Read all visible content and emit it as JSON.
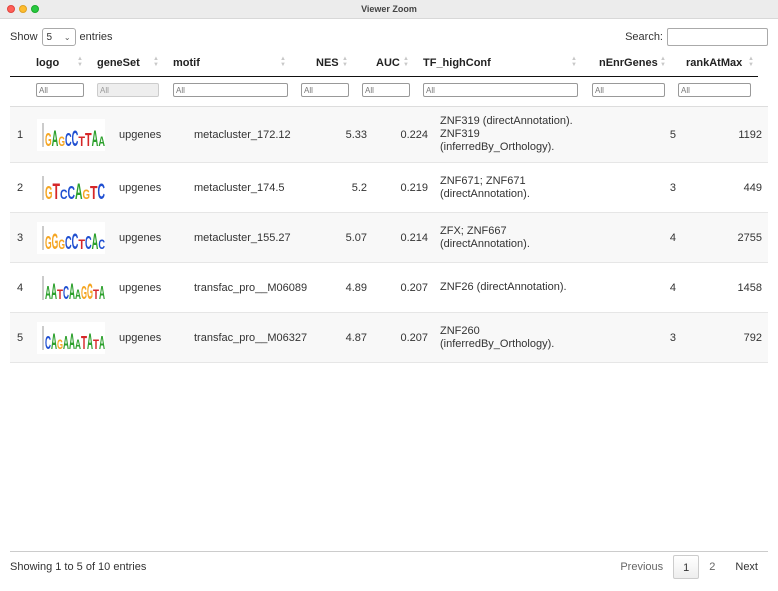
{
  "window": {
    "title": "Viewer Zoom"
  },
  "length_menu": {
    "show_label": "Show",
    "selected": "5",
    "entries_label": "entries"
  },
  "search": {
    "label": "Search:",
    "value": ""
  },
  "columns": [
    "logo",
    "geneSet",
    "motif",
    "NES",
    "AUC",
    "TF_highConf",
    "nEnrGenes",
    "rankAtMax"
  ],
  "filters": [
    "All",
    "All",
    "All",
    "All",
    "All",
    "All",
    "All",
    "All"
  ],
  "rows": [
    {
      "index": "1",
      "geneSet": "upgenes",
      "motif": "metacluster_172.12",
      "NES": "5.33",
      "AUC": "0.224",
      "tf_lines": [
        "ZNF319 (directAnnotation).",
        "ZNF319",
        "(inferredBy_Orthology)."
      ],
      "nEnrGenes": "5",
      "rankAtMax": "1192",
      "logo_letters": [
        [
          "G",
          "#f5a623"
        ],
        [
          "A",
          "#2ca02c"
        ],
        [
          "G",
          "#f5a623"
        ],
        [
          "C",
          "#1f4fd1"
        ],
        [
          "C",
          "#1f4fd1"
        ],
        [
          "T",
          "#d62728"
        ],
        [
          "T",
          "#d62728"
        ],
        [
          "A",
          "#2ca02c"
        ],
        [
          "A",
          "#2ca02c"
        ]
      ]
    },
    {
      "index": "2",
      "geneSet": "upgenes",
      "motif": "metacluster_174.5",
      "NES": "5.2",
      "AUC": "0.219",
      "tf_lines": [
        "ZNF671; ZNF671",
        "(directAnnotation)."
      ],
      "nEnrGenes": "3",
      "rankAtMax": "449",
      "logo_letters": [
        [
          "G",
          "#f5a623"
        ],
        [
          "T",
          "#d62728"
        ],
        [
          "C",
          "#1f4fd1"
        ],
        [
          "C",
          "#1f4fd1"
        ],
        [
          "A",
          "#2ca02c"
        ],
        [
          "G",
          "#f5a623"
        ],
        [
          "T",
          "#d62728"
        ],
        [
          "C",
          "#1f4fd1"
        ]
      ]
    },
    {
      "index": "3",
      "geneSet": "upgenes",
      "motif": "metacluster_155.27",
      "NES": "5.07",
      "AUC": "0.214",
      "tf_lines": [
        "ZFX; ZNF667",
        "(directAnnotation)."
      ],
      "nEnrGenes": "4",
      "rankAtMax": "2755",
      "logo_letters": [
        [
          "G",
          "#f5a623"
        ],
        [
          "G",
          "#f5a623"
        ],
        [
          "G",
          "#f5a623"
        ],
        [
          "C",
          "#1f4fd1"
        ],
        [
          "C",
          "#1f4fd1"
        ],
        [
          "T",
          "#d62728"
        ],
        [
          "C",
          "#1f4fd1"
        ],
        [
          "A",
          "#2ca02c"
        ],
        [
          "C",
          "#1f4fd1"
        ]
      ]
    },
    {
      "index": "4",
      "geneSet": "upgenes",
      "motif": "transfac_pro__M06089",
      "NES": "4.89",
      "AUC": "0.207",
      "tf_lines": [
        "ZNF26 (directAnnotation)."
      ],
      "nEnrGenes": "4",
      "rankAtMax": "1458",
      "logo_letters": [
        [
          "A",
          "#2ca02c"
        ],
        [
          "A",
          "#2ca02c"
        ],
        [
          "T",
          "#d62728"
        ],
        [
          "C",
          "#1f4fd1"
        ],
        [
          "A",
          "#2ca02c"
        ],
        [
          "A",
          "#2ca02c"
        ],
        [
          "G",
          "#f5a623"
        ],
        [
          "G",
          "#f5a623"
        ],
        [
          "T",
          "#d62728"
        ],
        [
          "A",
          "#2ca02c"
        ]
      ]
    },
    {
      "index": "5",
      "geneSet": "upgenes",
      "motif": "transfac_pro__M06327",
      "NES": "4.87",
      "AUC": "0.207",
      "tf_lines": [
        "ZNF260",
        "(inferredBy_Orthology)."
      ],
      "nEnrGenes": "3",
      "rankAtMax": "792",
      "logo_letters": [
        [
          "C",
          "#1f4fd1"
        ],
        [
          "A",
          "#2ca02c"
        ],
        [
          "G",
          "#f5a623"
        ],
        [
          "A",
          "#2ca02c"
        ],
        [
          "A",
          "#2ca02c"
        ],
        [
          "A",
          "#2ca02c"
        ],
        [
          "T",
          "#d62728"
        ],
        [
          "A",
          "#2ca02c"
        ],
        [
          "T",
          "#d62728"
        ],
        [
          "A",
          "#2ca02c"
        ]
      ]
    }
  ],
  "footer": {
    "info": "Showing 1 to 5 of 10 entries",
    "previous": "Previous",
    "pages": [
      "1",
      "2"
    ],
    "current_page": "1",
    "next": "Next"
  }
}
